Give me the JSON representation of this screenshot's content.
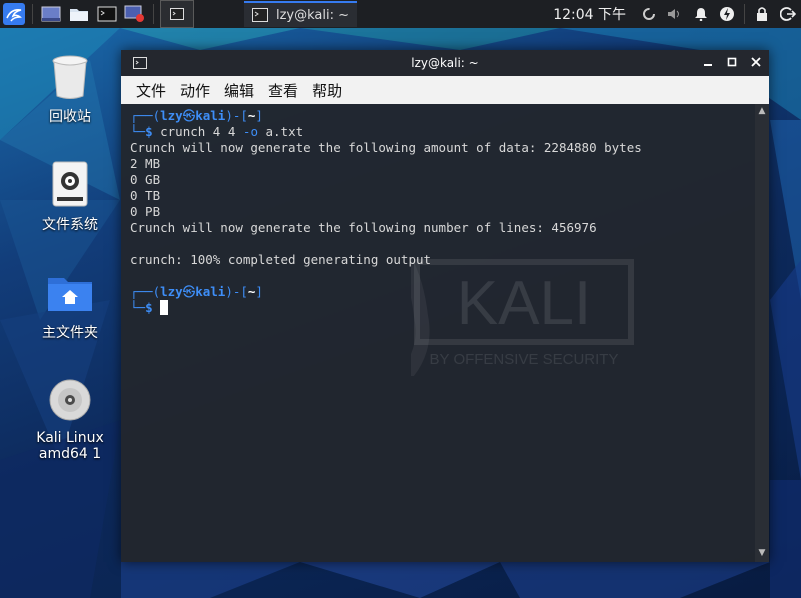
{
  "panel": {
    "task_title": "lzy@kali: ~",
    "clock": "12:04 下午"
  },
  "desktop": {
    "icons": [
      {
        "label": "回收站"
      },
      {
        "label": "文件系统"
      },
      {
        "label": "主文件夹"
      },
      {
        "label": "Kali Linux amd64 1"
      }
    ],
    "watermark": {
      "text": "KALI",
      "subtext": "BY OFFENSIVE SECURITY"
    }
  },
  "terminal": {
    "title": "lzy@kali: ~",
    "menu": [
      "文件",
      "动作",
      "编辑",
      "查看",
      "帮助"
    ],
    "prompt_user": "lzy",
    "prompt_symbol": "㉿",
    "prompt_host": "kali",
    "prompt_dir": "~",
    "command": "crunch 4 4 -o a.txt",
    "output": [
      "Crunch will now generate the following amount of data: 2284880 bytes",
      "2 MB",
      "0 GB",
      "0 TB",
      "0 PB",
      "Crunch will now generate the following number of lines: 456976",
      "",
      "crunch: 100% completed generating output"
    ]
  }
}
